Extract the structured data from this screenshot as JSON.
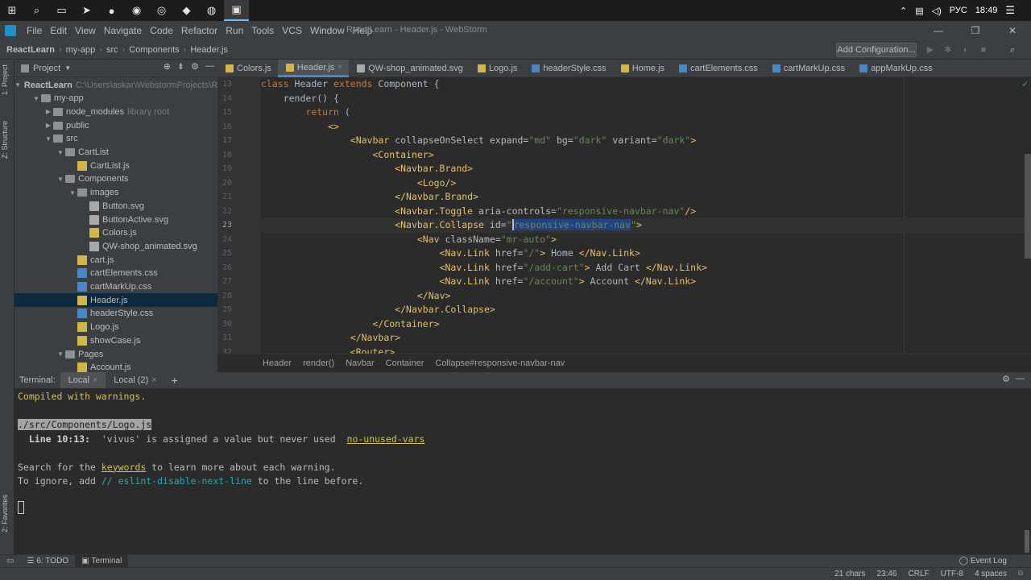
{
  "taskbar": {
    "apps": [
      {
        "name": "windows-start-icon",
        "glyph": "⊞"
      },
      {
        "name": "search-icon",
        "glyph": "⌕"
      },
      {
        "name": "file-explorer-icon",
        "glyph": "▭"
      },
      {
        "name": "telegram-icon",
        "glyph": "➤"
      },
      {
        "name": "media-player-icon",
        "glyph": "●"
      },
      {
        "name": "discord-icon",
        "glyph": "◉"
      },
      {
        "name": "opera-icon",
        "glyph": "◎"
      },
      {
        "name": "app-icon",
        "glyph": "◆"
      },
      {
        "name": "firefox-icon",
        "glyph": "◍"
      },
      {
        "name": "webstorm-icon",
        "glyph": "▣"
      }
    ],
    "tray": {
      "lang": "РУС",
      "time": "18:49"
    }
  },
  "menubar": {
    "items": [
      "File",
      "Edit",
      "View",
      "Navigate",
      "Code",
      "Refactor",
      "Run",
      "Tools",
      "VCS",
      "Window",
      "Help"
    ],
    "title": "ReactLearn - Header.js - WebStorm"
  },
  "navbar": {
    "crumbs": [
      "ReactLearn",
      "my-app",
      "src",
      "Components",
      "Header.js"
    ],
    "add_config": "Add Configuration..."
  },
  "left_stripe": {
    "project": "1: Project",
    "structure": "Z: Structure",
    "favorites": "2: Favorites"
  },
  "project": {
    "title": "Project",
    "tree": [
      {
        "label": "ReactLearn",
        "hint": "C:\\Users\\askar\\WebstormProjects\\Re",
        "indent": 0,
        "arrow": "▼",
        "type": "folder",
        "bold": true
      },
      {
        "label": "my-app",
        "hint": "",
        "indent": 1,
        "arrow": "▼",
        "type": "folder"
      },
      {
        "label": "node_modules",
        "hint": "library root",
        "indent": 2,
        "arrow": "▶",
        "type": "folder"
      },
      {
        "label": "public",
        "hint": "",
        "indent": 2,
        "arrow": "▶",
        "type": "folder"
      },
      {
        "label": "src",
        "hint": "",
        "indent": 2,
        "arrow": "▼",
        "type": "folder"
      },
      {
        "label": "CartList",
        "hint": "",
        "indent": 3,
        "arrow": "▼",
        "type": "folder"
      },
      {
        "label": "CartList.js",
        "hint": "",
        "indent": 4,
        "arrow": "",
        "type": "js"
      },
      {
        "label": "Components",
        "hint": "",
        "indent": 3,
        "arrow": "▼",
        "type": "folder"
      },
      {
        "label": "images",
        "hint": "",
        "indent": 4,
        "arrow": "▼",
        "type": "folder"
      },
      {
        "label": "Button.svg",
        "hint": "",
        "indent": 5,
        "arrow": "",
        "type": "svg"
      },
      {
        "label": "ButtonActive.svg",
        "hint": "",
        "indent": 5,
        "arrow": "",
        "type": "svg"
      },
      {
        "label": "Colors.js",
        "hint": "",
        "indent": 5,
        "arrow": "",
        "type": "js"
      },
      {
        "label": "QW-shop_animated.svg",
        "hint": "",
        "indent": 5,
        "arrow": "",
        "type": "svg"
      },
      {
        "label": "cart.js",
        "hint": "",
        "indent": 4,
        "arrow": "",
        "type": "js"
      },
      {
        "label": "cartElements.css",
        "hint": "",
        "indent": 4,
        "arrow": "",
        "type": "css"
      },
      {
        "label": "cartMarkUp.css",
        "hint": "",
        "indent": 4,
        "arrow": "",
        "type": "css"
      },
      {
        "label": "Header.js",
        "hint": "",
        "indent": 4,
        "arrow": "",
        "type": "js",
        "selected": true
      },
      {
        "label": "headerStyle.css",
        "hint": "",
        "indent": 4,
        "arrow": "",
        "type": "css"
      },
      {
        "label": "Logo.js",
        "hint": "",
        "indent": 4,
        "arrow": "",
        "type": "js"
      },
      {
        "label": "showCase.js",
        "hint": "",
        "indent": 4,
        "arrow": "",
        "type": "js"
      },
      {
        "label": "Pages",
        "hint": "",
        "indent": 3,
        "arrow": "▼",
        "type": "folder"
      },
      {
        "label": "Account.js",
        "hint": "",
        "indent": 4,
        "arrow": "",
        "type": "js"
      }
    ]
  },
  "tabs": [
    {
      "label": "Colors.js",
      "type": "js"
    },
    {
      "label": "Header.js",
      "type": "js",
      "active": true
    },
    {
      "label": "QW-shop_animated.svg",
      "type": "svg"
    },
    {
      "label": "Logo.js",
      "type": "js"
    },
    {
      "label": "headerStyle.css",
      "type": "css"
    },
    {
      "label": "Home.js",
      "type": "js"
    },
    {
      "label": "cartElements.css",
      "type": "css"
    },
    {
      "label": "cartMarkUp.css",
      "type": "css"
    },
    {
      "label": "appMarkUp.css",
      "type": "css"
    }
  ],
  "editor": {
    "line_numbers": [
      "13",
      "14",
      "15",
      "16",
      "17",
      "18",
      "19",
      "20",
      "21",
      "22",
      "23",
      "24",
      "25",
      "26",
      "27",
      "28",
      "29",
      "30",
      "31",
      "32"
    ],
    "current_line_index": 10
  },
  "crumbs": [
    "Header",
    "render()",
    "Navbar",
    "Container",
    "Collapse#responsive-navbar-nav"
  ],
  "terminal": {
    "label": "Terminal:",
    "tabs": [
      "Local",
      "Local (2)"
    ],
    "add": "+",
    "compiled": "Compiled with warnings.",
    "file": "./src/Components/Logo.js",
    "warn_line": "  Line 10:13:",
    "warn_msg": "  'vivus' is assigned a value but never used  ",
    "warn_rule": "no-unused-vars",
    "search_pre": "Search for the ",
    "search_link": "keywords",
    "search_post": " to learn more about each warning.",
    "ignore_pre": "To ignore, add ",
    "ignore_code": "// eslint-disable-next-line",
    "ignore_post": " to the line before."
  },
  "bottom": {
    "todo": "6: TODO",
    "terminal": "Terminal",
    "event_log": "Event Log"
  },
  "status": {
    "chars": "21 chars",
    "pos": "23:46",
    "crlf": "CRLF",
    "encoding": "UTF-8",
    "indent": "4 spaces"
  }
}
